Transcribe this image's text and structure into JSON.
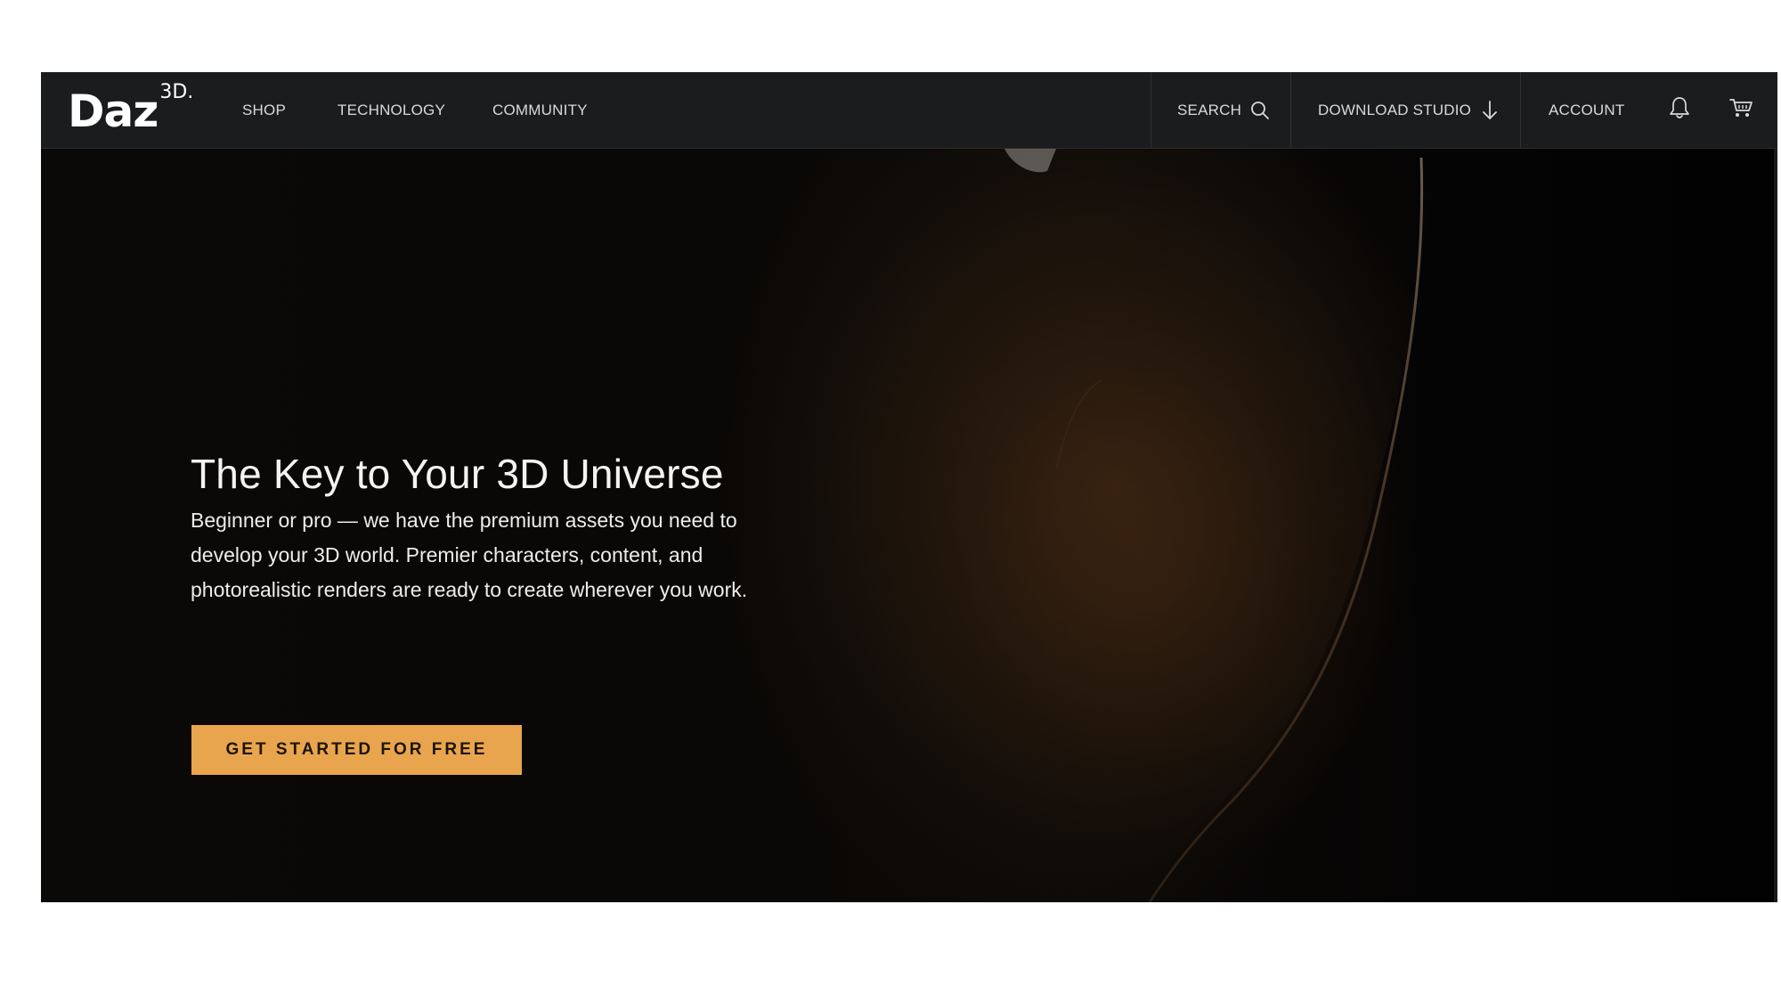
{
  "logo": {
    "main": "Daz",
    "sup": "3D."
  },
  "nav": {
    "shop": "SHOP",
    "technology": "TECHNOLOGY",
    "community": "COMMUNITY",
    "search": "SEARCH",
    "download_studio": "DOWNLOAD STUDIO",
    "account": "ACCOUNT"
  },
  "icons": {
    "search": "search-icon",
    "download": "arrow-down-icon",
    "notifications": "bell-icon",
    "cart": "cart-icon"
  },
  "hero": {
    "title": "The Key to Your 3D Universe",
    "body": "Beginner or pro — we have the premium assets you need to develop your 3D world. Premier characters, content, and photorealistic renders are ready to create wherever you work.",
    "cta_label": "GET STARTED FOR FREE"
  },
  "colors": {
    "header_bg": "#1b1c1e",
    "hero_bg": "#050505",
    "cta_bg": "#e9a54d",
    "nav_text": "#d9d9d9"
  }
}
